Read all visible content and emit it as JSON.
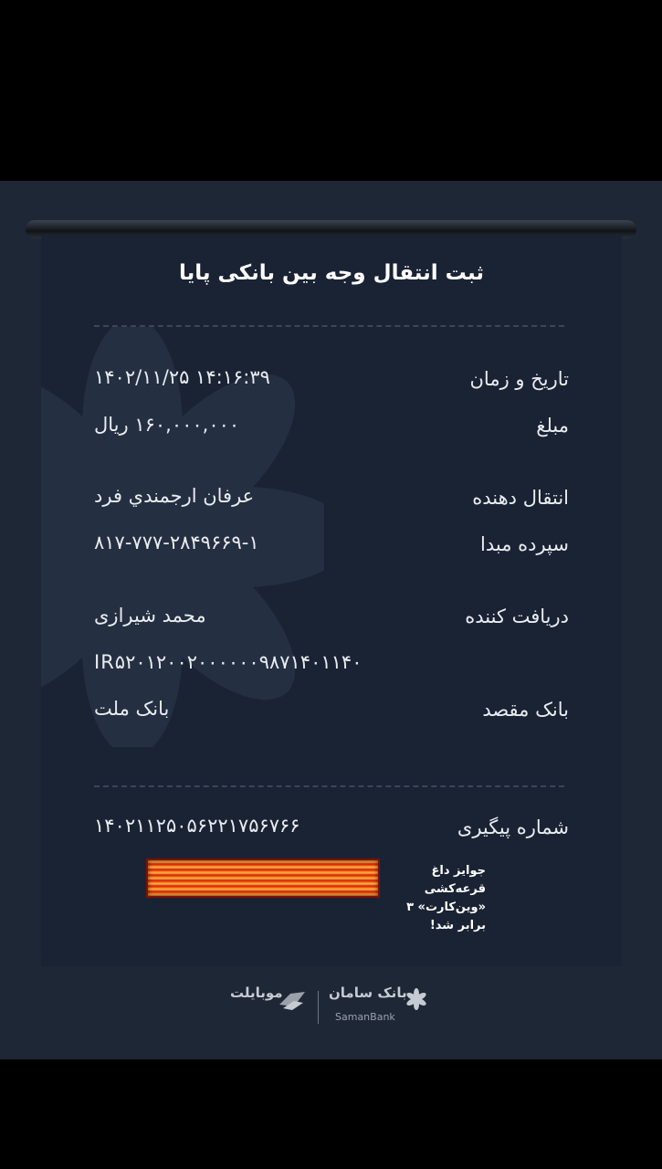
{
  "receipt": {
    "title": "ثبت انتقال وجه بین بانکی پایا",
    "rows": [
      {
        "label": "تاریخ و زمان",
        "value": "۱۴۰۲/۱۱/۲۵ ۱۴:۱۶:۳۹"
      },
      {
        "label": "مبلغ",
        "value": "۱۶۰,۰۰۰,۰۰۰ ریال"
      },
      {
        "label": "انتقال دهنده",
        "value": "عرفان ارجمندي فرد"
      },
      {
        "label": "سپرده مبدا",
        "value": "۸۱۷-۷۷۷-۲۸۴۹۶۶۹-۱"
      },
      {
        "label": "دریافت کننده",
        "value": "محمد شیرازی"
      },
      {
        "label": "",
        "value": "IR۵۲۰۱۲۰۰۲۰۰۰۰۰۰۹۸۷۱۴۰۱۱۴۰"
      },
      {
        "label": "بانک مقصد",
        "value": "بانک ملت"
      }
    ],
    "tracking": {
      "label": "شماره پیگیری",
      "value": "۱۴۰۲۱۱۲۵۰۵۶۲۲۱۷۵۶۷۶۶"
    }
  },
  "promo": {
    "line1": "جوایز داغ قرعه‌کشی",
    "line2": "«وین‌کارت» ۳ برابر شد!"
  },
  "footer": {
    "brand_left": "موبایلت",
    "brand_right": "بانک سامان",
    "brand_right_en": "SamanBank"
  },
  "colors": {
    "background": "#1e2736",
    "paper": "#1a2334",
    "text": "#e9ecf1"
  }
}
